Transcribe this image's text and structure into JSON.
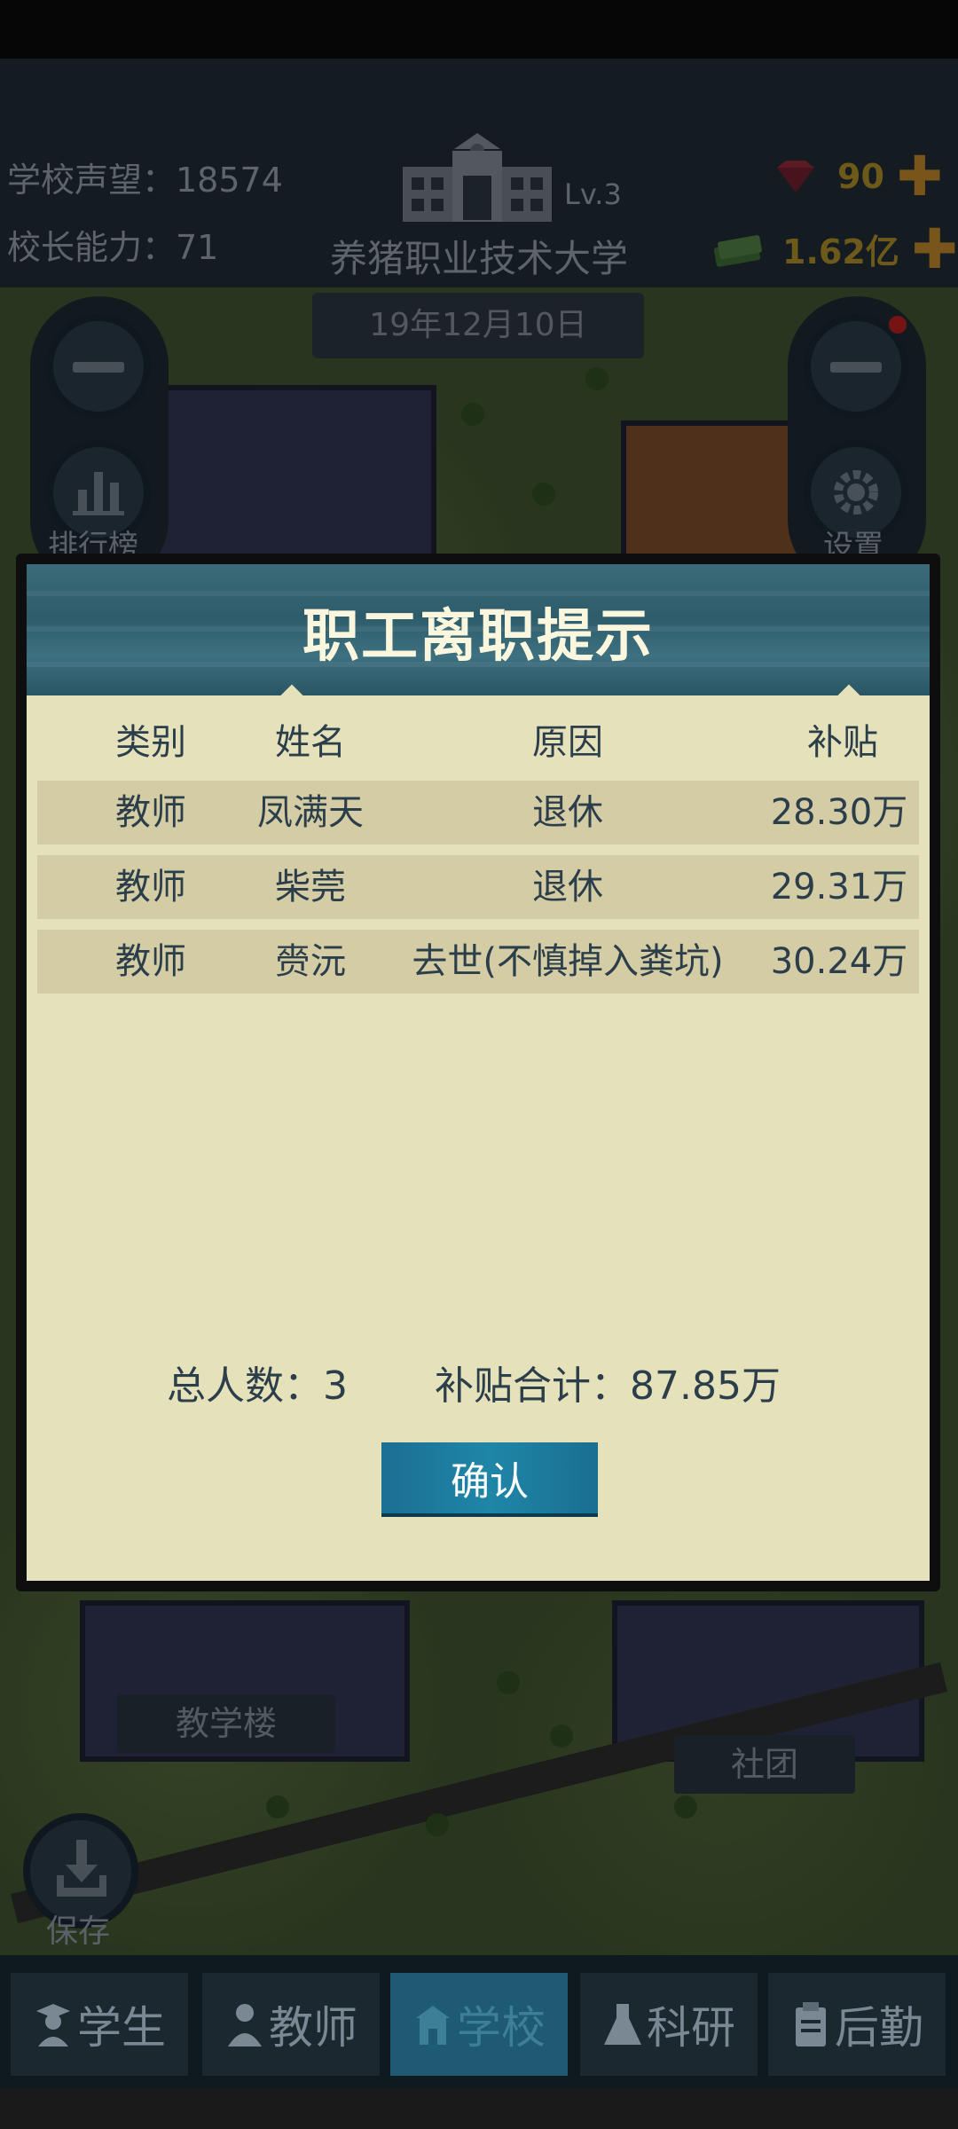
{
  "header": {
    "reputation_label": "学校声望：18574",
    "ability_label": "校长能力：71",
    "school_name": "养猪职业技术大学",
    "level": "Lv.3",
    "date": "19年12月10日",
    "gems": "90",
    "money": "1.62亿"
  },
  "side": {
    "rank_label": "排行榜",
    "settings_label": "设置",
    "save_label": "保存"
  },
  "dialog": {
    "title": "职工离职提示",
    "columns": [
      "类别",
      "姓名",
      "原因",
      "补贴"
    ],
    "rows": [
      {
        "type": "教师",
        "name": "凤满天",
        "reason": "退休",
        "subsidy": "28.30万"
      },
      {
        "type": "教师",
        "name": "柴莞",
        "reason": "退休",
        "subsidy": "29.31万"
      },
      {
        "type": "教师",
        "name": "赍沅",
        "reason": "去世(不慎掉入粪坑)",
        "subsidy": "30.24万"
      }
    ],
    "total_people": "总人数：3",
    "total_subsidy": "补贴合计：87.85万",
    "confirm_label": "确认"
  },
  "map_tags": {
    "teaching_building": "教学楼",
    "club": "社团"
  },
  "nav": {
    "tabs": [
      {
        "label": "学生",
        "icon": "student-icon"
      },
      {
        "label": "教师",
        "icon": "teacher-icon"
      },
      {
        "label": "学校",
        "icon": "school-icon"
      },
      {
        "label": "科研",
        "icon": "flask-icon"
      },
      {
        "label": "后勤",
        "icon": "clipboard-icon"
      }
    ],
    "active_tab": "学校"
  },
  "colors": {
    "dialog_bg": "#e5e2bb",
    "row_bg": "#d3cca4",
    "header_teal": "#2e5c6a",
    "confirm_blue": "#1f86a8",
    "gold": "#a88a2a"
  }
}
